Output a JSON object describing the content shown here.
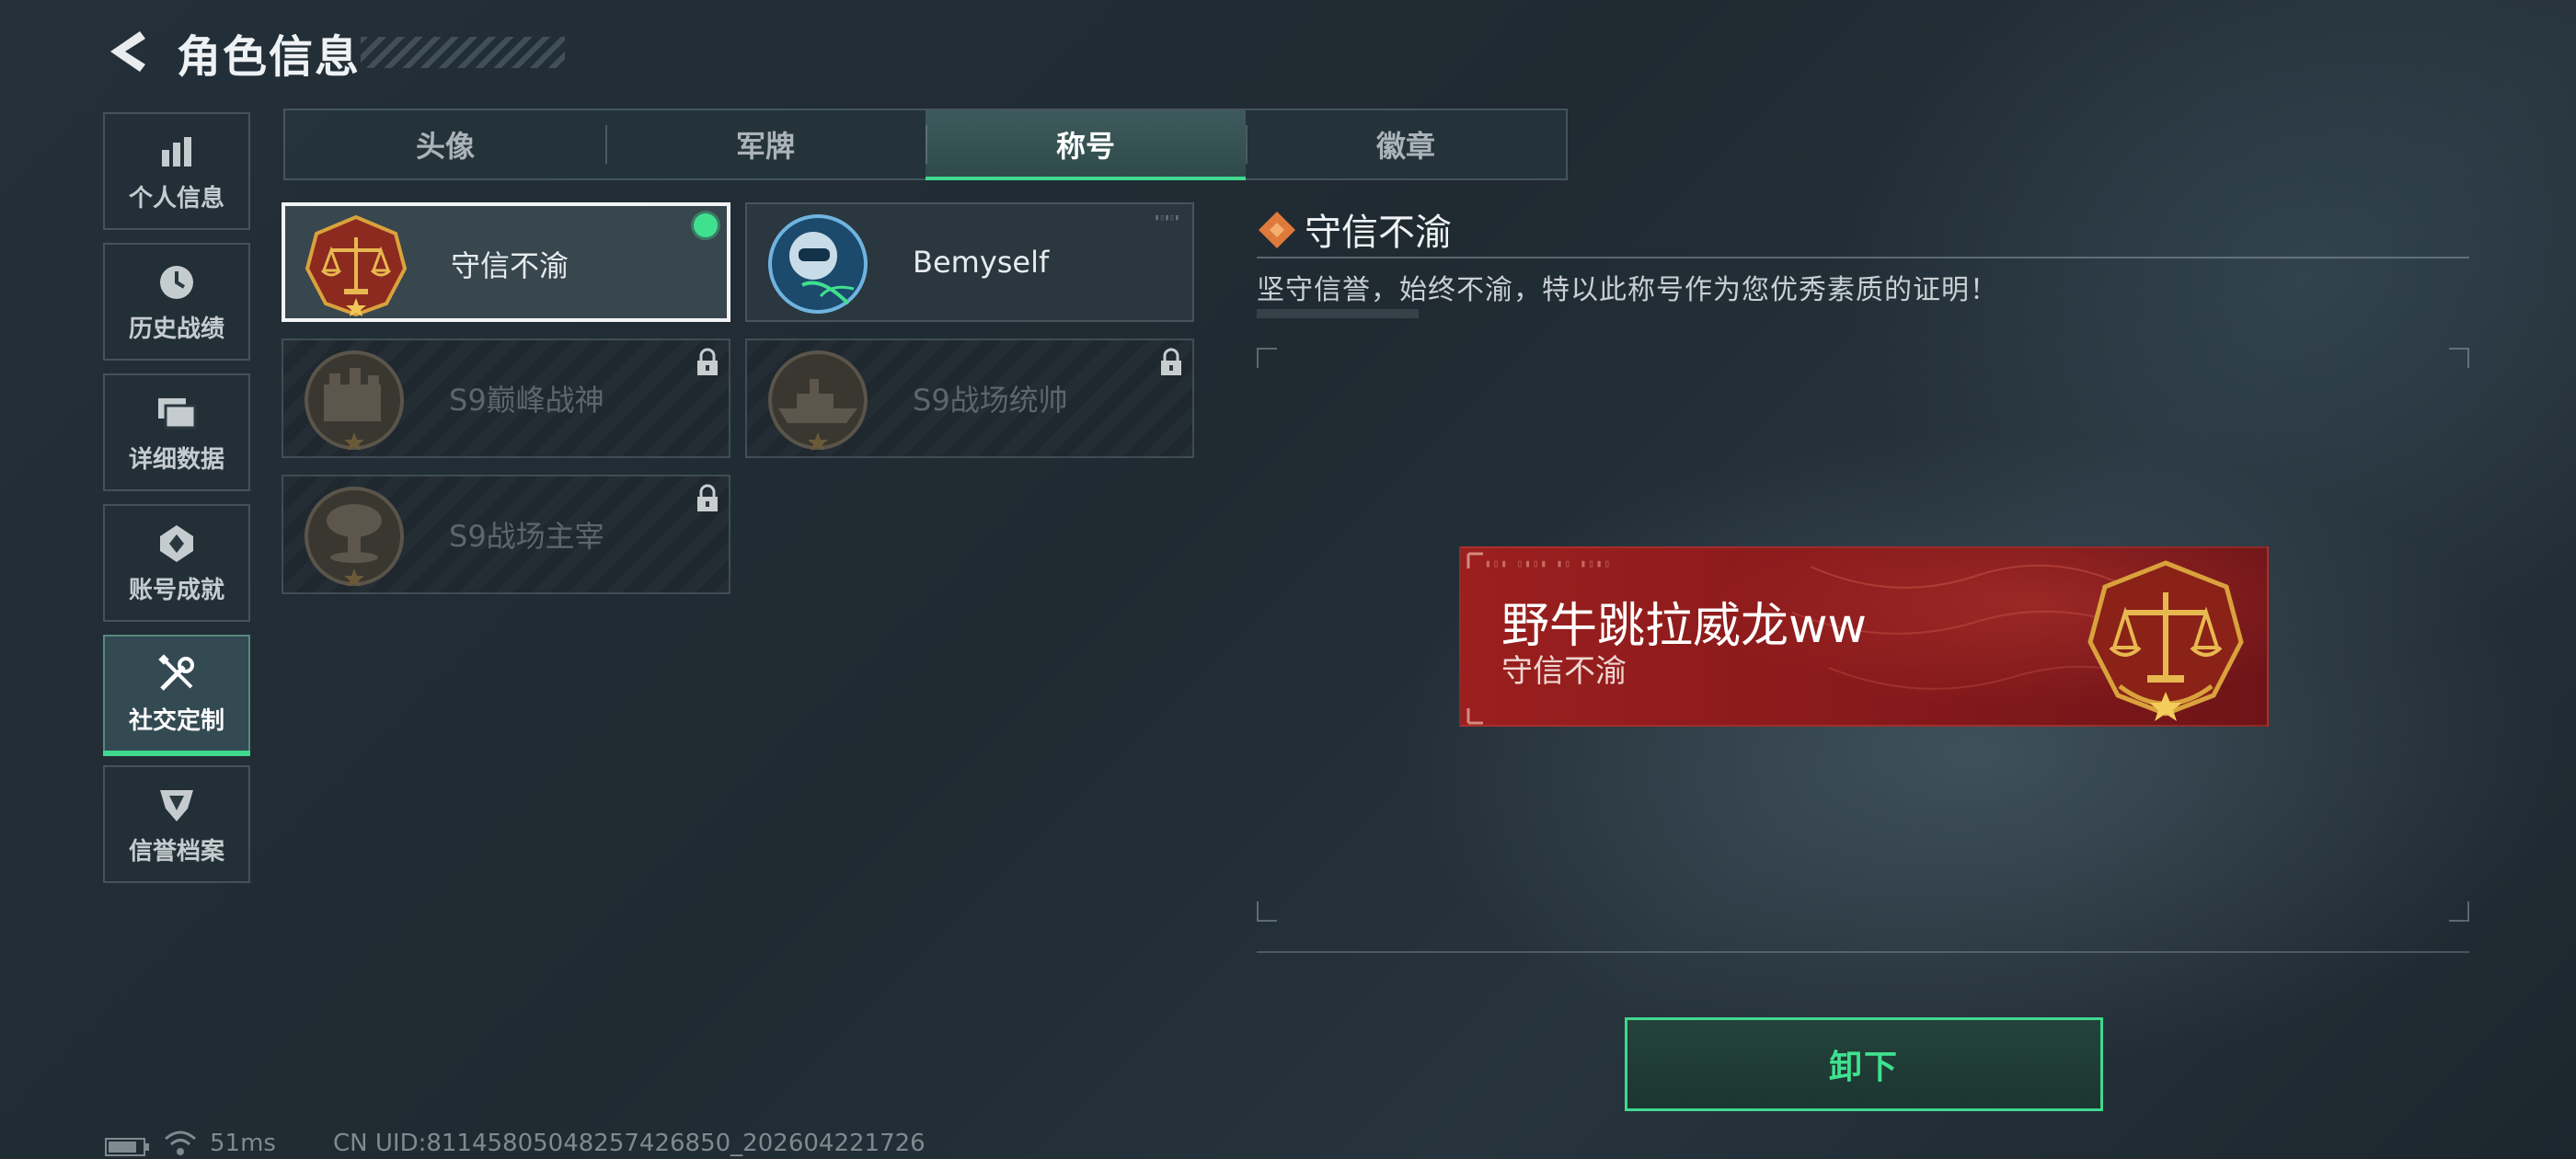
{
  "header": {
    "title": "角色信息"
  },
  "sidebar": {
    "items": [
      {
        "label": "个人信息",
        "icon": "bar-chart-icon"
      },
      {
        "label": "历史战绩",
        "icon": "history-clock-icon"
      },
      {
        "label": "详细数据",
        "icon": "folders-icon"
      },
      {
        "label": "账号成就",
        "icon": "achievement-badge-icon"
      },
      {
        "label": "社交定制",
        "icon": "tools-wrench-icon",
        "active": true
      },
      {
        "label": "信誉档案",
        "icon": "credit-shield-icon"
      }
    ]
  },
  "tabs": [
    {
      "label": "头像"
    },
    {
      "label": "军牌"
    },
    {
      "label": "称号",
      "active": true
    },
    {
      "label": "徽章"
    }
  ],
  "titles": [
    {
      "name": "守信不渝",
      "emblem": "scales-emblem-icon",
      "state": "equipped"
    },
    {
      "name": "Bemyself",
      "emblem": "astronaut-emblem-icon",
      "state": "owned"
    },
    {
      "name": "S9巅峰战神",
      "emblem": "fortress-emblem-icon",
      "state": "locked"
    },
    {
      "name": "S9战场统帅",
      "emblem": "warship-emblem-icon",
      "state": "locked"
    },
    {
      "name": "S9战场主宰",
      "emblem": "mushroom-cloud-emblem-icon",
      "state": "locked"
    }
  ],
  "detail": {
    "title": "守信不渝",
    "description": "坚守信誉，始终不渝，特以此称号作为您优秀素质的证明！"
  },
  "nameplate": {
    "player_name": "野牛跳拉威龙ww",
    "title": "守信不渝"
  },
  "actions": {
    "unequip_label": "卸下"
  },
  "status": {
    "ping": "51ms",
    "uid": "CN UID:811458050482574268​50_202604221726"
  },
  "colors": {
    "accent": "#3fd88f",
    "nameplate_red": "#9b1f1e",
    "gold": "#d9a23c"
  }
}
